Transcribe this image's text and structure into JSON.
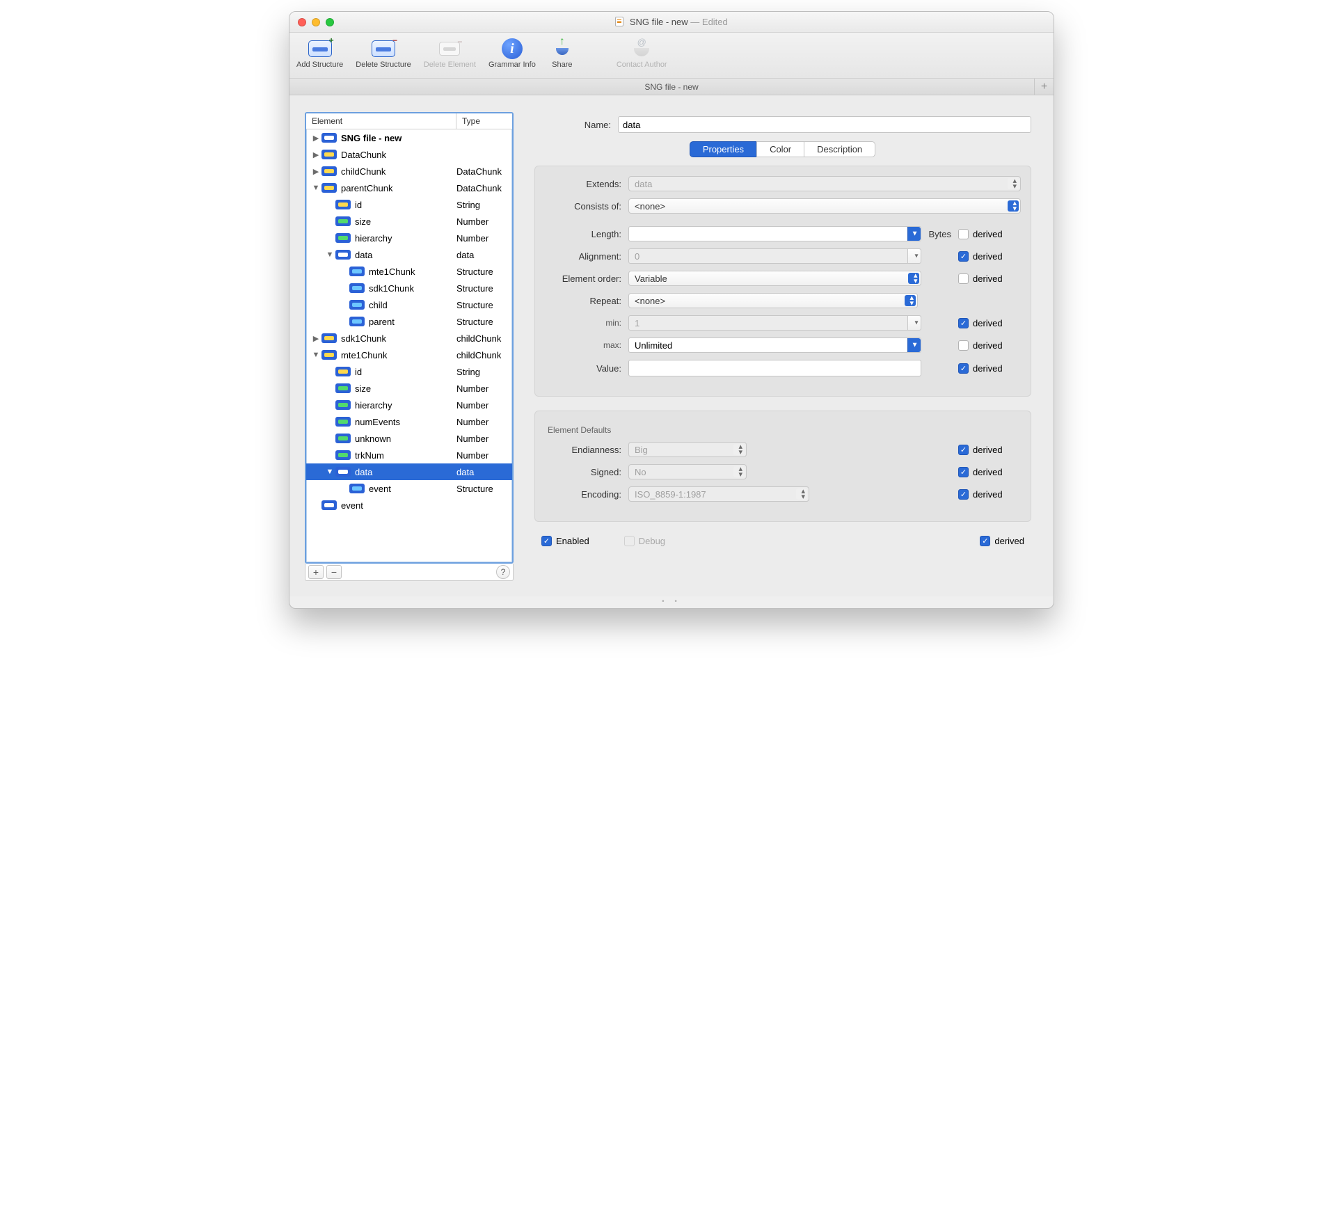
{
  "window": {
    "title": "SNG file - new",
    "edited": "— Edited"
  },
  "toolbar": {
    "add_structure": "Add Structure",
    "delete_structure": "Delete Structure",
    "delete_element": "Delete Element",
    "grammar_info": "Grammar Info",
    "share": "Share",
    "contact_author": "Contact Author"
  },
  "tabbar": {
    "tab": "SNG file - new"
  },
  "tree": {
    "columns": {
      "element": "Element",
      "type": "Type"
    },
    "rows": [
      {
        "indent": 0,
        "disc": "▶",
        "icon": "white",
        "name": "SNG file - new",
        "type": "",
        "bold": true
      },
      {
        "indent": 0,
        "disc": "▶",
        "icon": "yellow",
        "name": "DataChunk",
        "type": ""
      },
      {
        "indent": 0,
        "disc": "▶",
        "icon": "yellow",
        "name": "childChunk",
        "type": "DataChunk"
      },
      {
        "indent": 0,
        "disc": "▼",
        "icon": "yellow",
        "name": "parentChunk",
        "type": "DataChunk"
      },
      {
        "indent": 1,
        "disc": "",
        "icon": "yellow",
        "name": "id",
        "type": "String"
      },
      {
        "indent": 1,
        "disc": "",
        "icon": "green",
        "name": "size",
        "type": "Number"
      },
      {
        "indent": 1,
        "disc": "",
        "icon": "green",
        "name": "hierarchy",
        "type": "Number"
      },
      {
        "indent": 1,
        "disc": "▼",
        "icon": "white",
        "name": "data",
        "type": "data"
      },
      {
        "indent": 2,
        "disc": "",
        "icon": "blue",
        "name": "mte1Chunk",
        "type": "Structure"
      },
      {
        "indent": 2,
        "disc": "",
        "icon": "blue",
        "name": "sdk1Chunk",
        "type": "Structure"
      },
      {
        "indent": 2,
        "disc": "",
        "icon": "blue",
        "name": "child",
        "type": "Structure"
      },
      {
        "indent": 2,
        "disc": "",
        "icon": "blue",
        "name": "parent",
        "type": "Structure"
      },
      {
        "indent": 0,
        "disc": "▶",
        "icon": "yellow",
        "name": "sdk1Chunk",
        "type": "childChunk"
      },
      {
        "indent": 0,
        "disc": "▼",
        "icon": "yellow",
        "name": "mte1Chunk",
        "type": "childChunk"
      },
      {
        "indent": 1,
        "disc": "",
        "icon": "yellow",
        "name": "id",
        "type": "String"
      },
      {
        "indent": 1,
        "disc": "",
        "icon": "green",
        "name": "size",
        "type": "Number"
      },
      {
        "indent": 1,
        "disc": "",
        "icon": "green",
        "name": "hierarchy",
        "type": "Number"
      },
      {
        "indent": 1,
        "disc": "",
        "icon": "green",
        "name": "numEvents",
        "type": "Number"
      },
      {
        "indent": 1,
        "disc": "",
        "icon": "green",
        "name": "unknown",
        "type": "Number"
      },
      {
        "indent": 1,
        "disc": "",
        "icon": "green",
        "name": "trkNum",
        "type": "Number"
      },
      {
        "indent": 1,
        "disc": "▼",
        "icon": "white",
        "name": "data",
        "type": "data",
        "selected": true
      },
      {
        "indent": 2,
        "disc": "",
        "icon": "blue",
        "name": "event",
        "type": "Structure"
      },
      {
        "indent": 0,
        "disc": "",
        "icon": "white",
        "name": "event",
        "type": ""
      }
    ]
  },
  "properties": {
    "name_label": "Name:",
    "name_value": "data",
    "tabs": {
      "properties": "Properties",
      "color": "Color",
      "description": "Description"
    },
    "extends_label": "Extends:",
    "extends_value": "data",
    "consists_label": "Consists of:",
    "consists_value": "<none>",
    "length_label": "Length:",
    "length_value": "",
    "length_unit": "Bytes",
    "alignment_label": "Alignment:",
    "alignment_value": "0",
    "order_label": "Element order:",
    "order_value": "Variable",
    "repeat_label": "Repeat:",
    "repeat_value": "<none>",
    "min_label": "min:",
    "min_value": "1",
    "max_label": "max:",
    "max_value": "Unlimited",
    "value_label": "Value:",
    "value_value": "",
    "defaults_title": "Element Defaults",
    "endian_label": "Endianness:",
    "endian_value": "Big",
    "signed_label": "Signed:",
    "signed_value": "No",
    "encoding_label": "Encoding:",
    "encoding_value": "ISO_8859-1:1987",
    "derived_label": "derived",
    "enabled_label": "Enabled",
    "debug_label": "Debug",
    "checks": {
      "length_derived": false,
      "alignment_derived": true,
      "order_derived": false,
      "min_derived": true,
      "max_derived": false,
      "value_derived": true,
      "endian_derived": true,
      "signed_derived": true,
      "encoding_derived": true,
      "enabled": true,
      "debug": false,
      "bottom_derived": true
    }
  }
}
